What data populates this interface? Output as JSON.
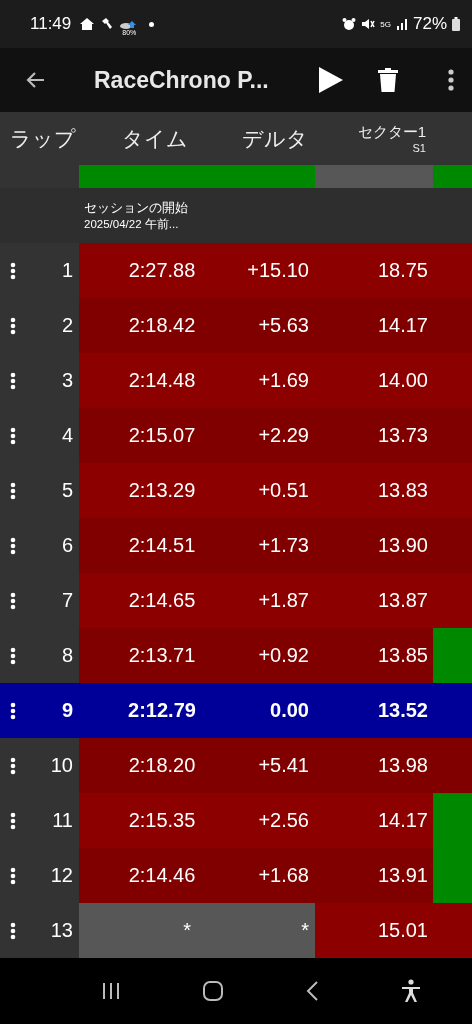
{
  "status_bar": {
    "time": "11:49",
    "weather_badge": "80%",
    "network": "5G",
    "battery": "72%"
  },
  "toolbar": {
    "title": "RaceChrono P..."
  },
  "table": {
    "columns": [
      {
        "label": "ラップ"
      },
      {
        "label": "タイム"
      },
      {
        "label": "デルタ"
      },
      {
        "label": "セクター1",
        "sub": "S1"
      }
    ],
    "hidden_row": {
      "kind": "green",
      "sector_best": true
    },
    "session": {
      "title": "セッションの開始",
      "date": "2025/04/22 午前..."
    },
    "rows": [
      {
        "lap": "1",
        "time": "2:27.88",
        "delta": "+15.10",
        "sector": "18.75",
        "kind": "normal",
        "sector_best": false
      },
      {
        "lap": "2",
        "time": "2:18.42",
        "delta": "+5.63",
        "sector": "14.17",
        "kind": "normal",
        "sector_best": false
      },
      {
        "lap": "3",
        "time": "2:14.48",
        "delta": "+1.69",
        "sector": "14.00",
        "kind": "normal",
        "sector_best": false
      },
      {
        "lap": "4",
        "time": "2:15.07",
        "delta": "+2.29",
        "sector": "13.73",
        "kind": "normal",
        "sector_best": false
      },
      {
        "lap": "5",
        "time": "2:13.29",
        "delta": "+0.51",
        "sector": "13.83",
        "kind": "normal",
        "sector_best": false
      },
      {
        "lap": "6",
        "time": "2:14.51",
        "delta": "+1.73",
        "sector": "13.90",
        "kind": "normal",
        "sector_best": false
      },
      {
        "lap": "7",
        "time": "2:14.65",
        "delta": "+1.87",
        "sector": "13.87",
        "kind": "normal",
        "sector_best": false
      },
      {
        "lap": "8",
        "time": "2:13.71",
        "delta": "+0.92",
        "sector": "13.85",
        "kind": "normal",
        "sector_best": true
      },
      {
        "lap": "9",
        "time": "2:12.79",
        "delta": "0.00",
        "sector": "13.52",
        "kind": "best",
        "sector_best": false
      },
      {
        "lap": "10",
        "time": "2:18.20",
        "delta": "+5.41",
        "sector": "13.98",
        "kind": "normal",
        "sector_best": false
      },
      {
        "lap": "11",
        "time": "2:15.35",
        "delta": "+2.56",
        "sector": "14.17",
        "kind": "normal",
        "sector_best": true
      },
      {
        "lap": "12",
        "time": "2:14.46",
        "delta": "+1.68",
        "sector": "13.91",
        "kind": "normal",
        "sector_best": true
      },
      {
        "lap": "13",
        "time": "*",
        "delta": "*",
        "sector": "15.01",
        "kind": "incomplete",
        "sector_best": false
      }
    ]
  }
}
